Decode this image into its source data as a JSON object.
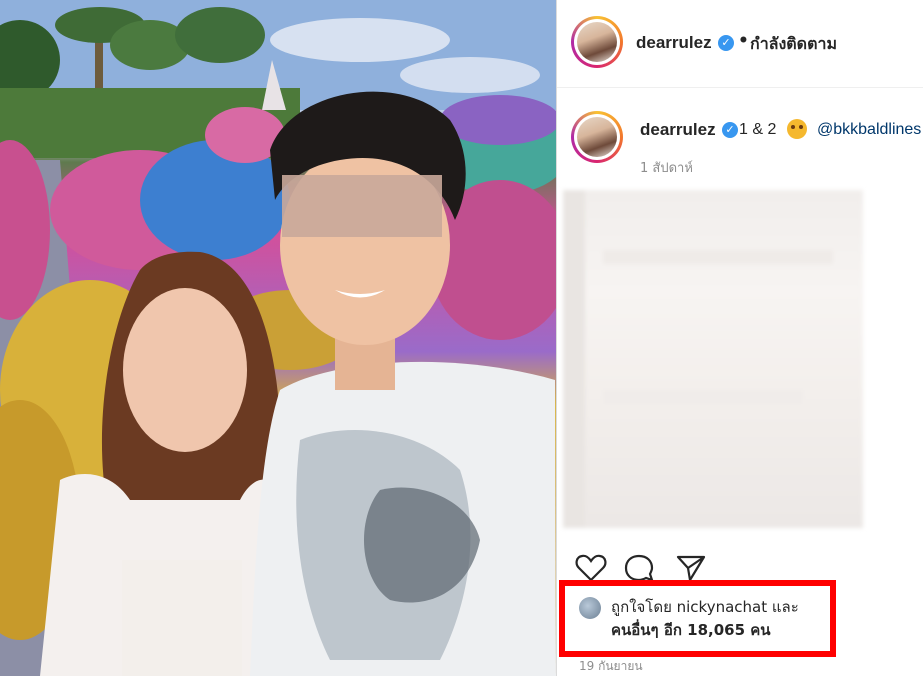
{
  "post": {
    "username": "dearrulez",
    "follow_status": "กำลังติดตาม",
    "caption_prefix": "1 & 2",
    "caption_mention": "@bkkbaldlines",
    "posted_ago": "1 สัปดาห์",
    "likes_line1": "ถูกใจโดย nickynachat และ",
    "likes_line2": "คนอื่นๆ อีก 18,065 คน",
    "date": "19 กันยายน"
  },
  "icons": {
    "verified": "verified-badge-icon",
    "like": "heart-icon",
    "comment": "comment-icon",
    "share": "paper-plane-icon"
  },
  "colors": {
    "highlight_border": "#ff0000",
    "verified": "#3897f0",
    "mention": "#00376b"
  }
}
